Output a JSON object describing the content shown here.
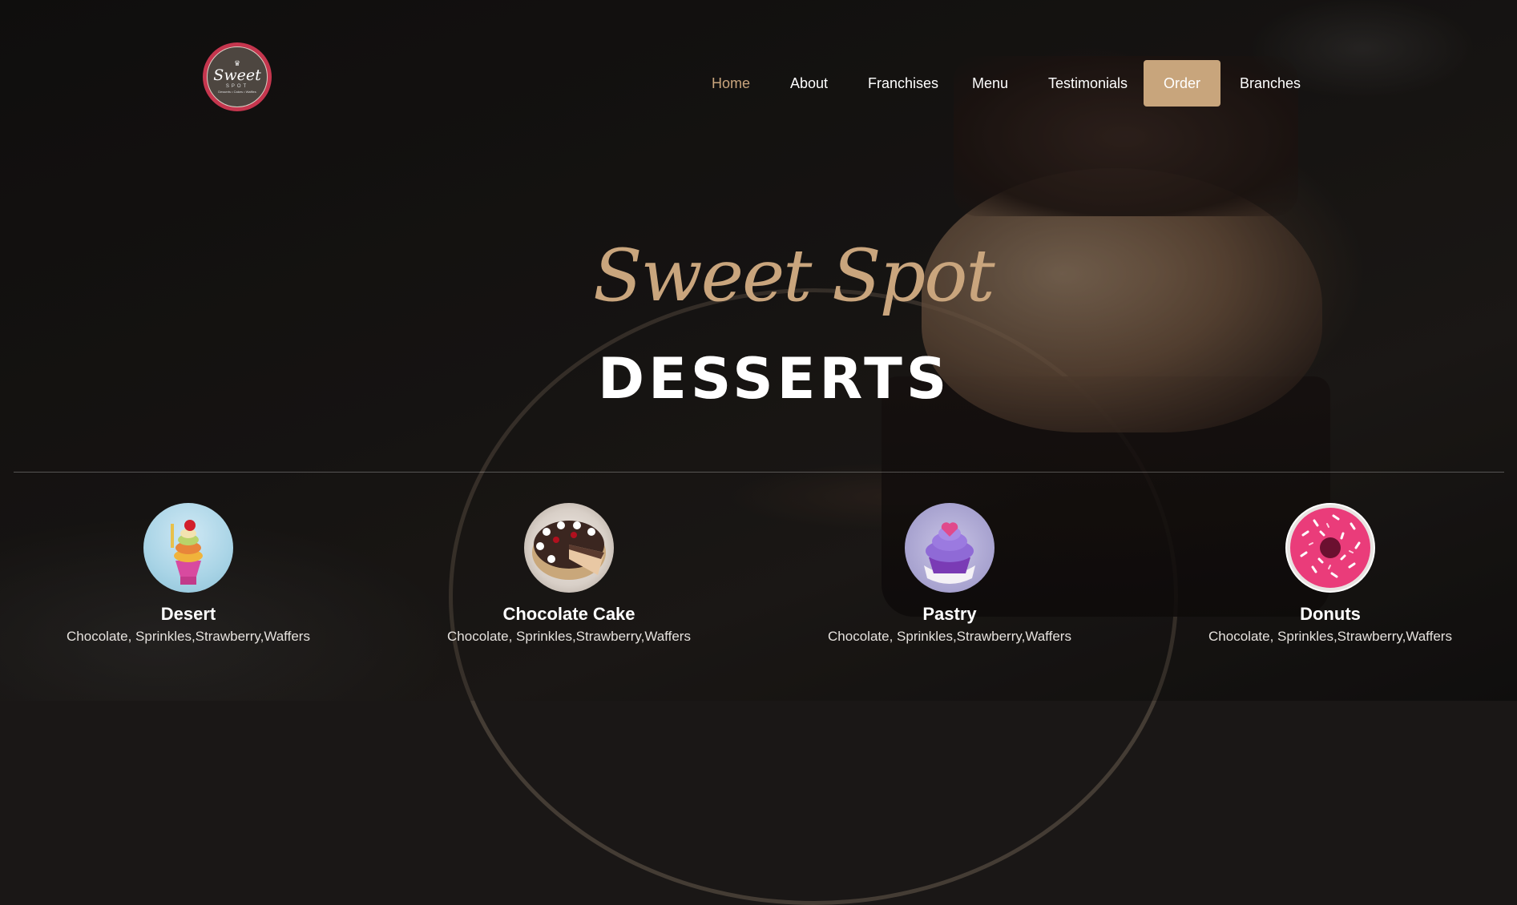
{
  "brand": {
    "logo_word": "Sweet",
    "logo_sub": "SPOT",
    "logo_tagline": "Desserts • Cakes • Waffles"
  },
  "nav": {
    "items": [
      {
        "label": "Home",
        "active": true
      },
      {
        "label": "About"
      },
      {
        "label": "Franchises"
      },
      {
        "label": "Menu"
      },
      {
        "label": "Testimonials"
      },
      {
        "label": "Order",
        "highlight": true
      },
      {
        "label": "Branches"
      }
    ]
  },
  "hero": {
    "script_title": "Sweet Spot",
    "title": "DESSERTS"
  },
  "categories": [
    {
      "name": "Desert",
      "desc": "Chocolate, Sprinkles,Strawberry,Waffers",
      "icon": "parfait-image"
    },
    {
      "name": "Chocolate Cake",
      "desc": "Chocolate, Sprinkles,Strawberry,Waffers",
      "icon": "chocolate-cake-image"
    },
    {
      "name": "Pastry",
      "desc": "Chocolate, Sprinkles,Strawberry,Waffers",
      "icon": "cupcake-image"
    },
    {
      "name": "Donuts",
      "desc": "Chocolate, Sprinkles,Strawberry,Waffers",
      "icon": "donut-image"
    }
  ],
  "colors": {
    "accent": "#c9a57d",
    "order_button": "#c8a57c",
    "logo_ring": "#c5364e",
    "background": "#1a1716"
  }
}
